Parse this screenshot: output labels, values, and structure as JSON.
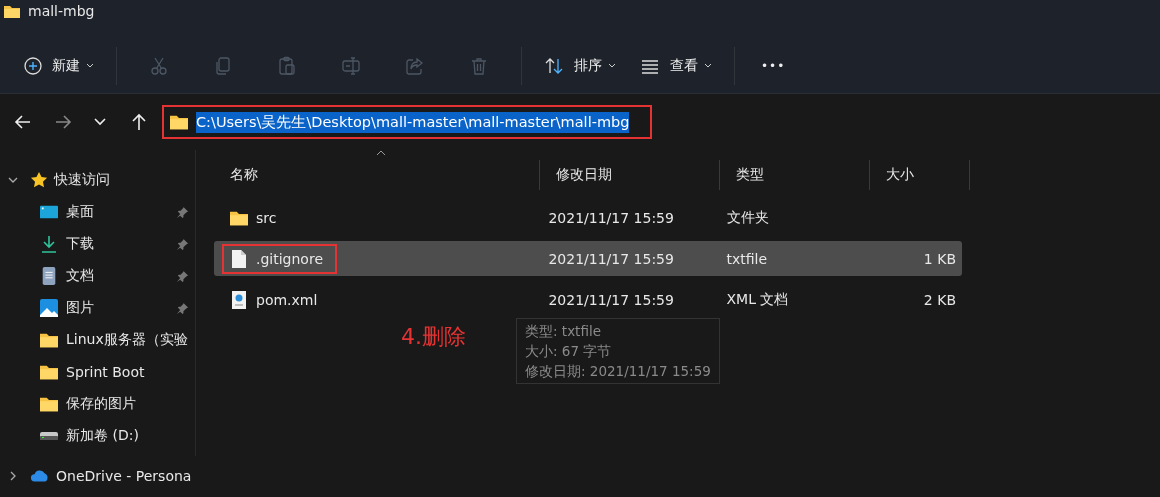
{
  "window": {
    "title": "mall-mbg"
  },
  "toolbar": {
    "new_button": "新建",
    "actions": [
      {
        "kind": "cut",
        "disabled": true
      },
      {
        "kind": "copy",
        "disabled": true
      },
      {
        "kind": "paste",
        "disabled": true
      },
      {
        "kind": "rename",
        "disabled": true
      },
      {
        "kind": "share",
        "disabled": true
      },
      {
        "kind": "delete",
        "disabled": true
      }
    ],
    "sort_button": "排序",
    "view_button": "查看",
    "more_button": "•••"
  },
  "address_bar": {
    "path": "C:\\Users\\吴先生\\Desktop\\mall-master\\mall-master\\mall-mbg",
    "selected": true,
    "annotated": true
  },
  "sidebar": {
    "items": [
      {
        "label": "快速访问",
        "kind": "star",
        "expanded": true,
        "children": [
          {
            "label": "桌面",
            "kind": "desktop",
            "pinned": true
          },
          {
            "label": "下载",
            "kind": "download",
            "pinned": true
          },
          {
            "label": "文档",
            "kind": "document",
            "pinned": true
          },
          {
            "label": "图片",
            "kind": "pictures",
            "pinned": true
          },
          {
            "label": "Linux服务器（实验",
            "kind": "folder",
            "pinned": false
          },
          {
            "label": "Sprint Boot",
            "kind": "folder",
            "pinned": false
          },
          {
            "label": "保存的图片",
            "kind": "folder",
            "pinned": false
          },
          {
            "label": "新加卷 (D:)",
            "kind": "drive",
            "pinned": false
          }
        ]
      },
      {
        "label": "OneDrive - Persona",
        "kind": "cloud",
        "expanded": false
      }
    ]
  },
  "table": {
    "columns": [
      "名称",
      "修改日期",
      "类型",
      "大小"
    ],
    "rows": [
      {
        "name": "src",
        "kind": "folder",
        "modified": "2021/11/17 15:59",
        "type": "文件夹",
        "selected": false,
        "annotated": false
      },
      {
        "name": ".gitignore",
        "kind": "text",
        "modified": "2021/11/17 15:59",
        "type": "txtfile",
        "size": "1 KB",
        "selected": true,
        "annotated": true
      },
      {
        "name": "pom.xml",
        "kind": "xml",
        "modified": "2021/11/17 15:59",
        "type": "XML 文档",
        "size": "2 KB",
        "selected": false,
        "annotated": false
      }
    ]
  },
  "tooltip": [
    "类型: txtfile",
    "大小: 67 字节",
    "修改日期: 2021/11/17 15:59"
  ],
  "annotation": "4.删除"
}
